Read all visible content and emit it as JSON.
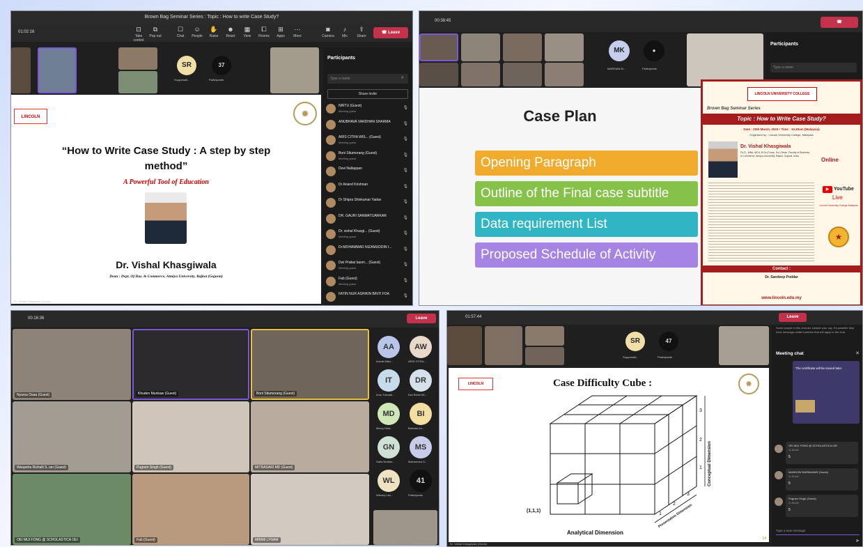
{
  "panel1": {
    "window_title": "Brown Bag Seminar Series : Topic : How to write Case Study?",
    "timer": "01:02:16",
    "toolbar": [
      "Take control",
      "Pop out",
      "Chat",
      "People",
      "Raise",
      "React",
      "View",
      "Rooms",
      "Apps",
      "More",
      "Camera",
      "Mic",
      "Share"
    ],
    "leave_label": "Leave",
    "tiles": {
      "sr_initials": "SR",
      "sr_name": "Suppamali...",
      "participants_count": "37",
      "participants_label": "Participants"
    },
    "participants_header": "Participants",
    "search_placeholder": "Type a name",
    "share_invite": "Share invite",
    "participants": [
      {
        "name": "NIRTU (Guest)",
        "sub": "Meeting guest"
      },
      {
        "name": "ANUBHAVA VARDHAN SHARMA",
        "sub": ""
      },
      {
        "name": "ARIS CITRA WIS... (Guest)",
        "sub": "Meeting guest"
      },
      {
        "name": "Boni Situmorang (Guest)",
        "sub": "Meeting guest"
      },
      {
        "name": "Devi Nallappan",
        "sub": ""
      },
      {
        "name": "Dr Anand Krishnan",
        "sub": ""
      },
      {
        "name": "Dr Shipra Shivkumar Yadav",
        "sub": ""
      },
      {
        "name": "DR. GAURI SANMATIJARKAR",
        "sub": ""
      },
      {
        "name": "Dr. vishal Khasgi... (Guest)",
        "sub": "Meeting guest"
      },
      {
        "name": "Dr.MOHAMMAD NIZAMUDDIN I...",
        "sub": ""
      },
      {
        "name": "Dwi Prabai basm... (Guest)",
        "sub": "Meeting guest"
      },
      {
        "name": "Fab (Guest)",
        "sub": "Meeting guest"
      },
      {
        "name": "FATIN NUR ASHIKIN BINTI FOA",
        "sub": ""
      }
    ],
    "slide": {
      "title_line1": "“How to Write Case Study : A step by step",
      "title_line2": "method”",
      "subtitle": "A Powerful Tool of Education",
      "speaker": "Dr. Vishal Khasgiwala",
      "affiliation": "Dean : Dept. Of Bus. & Commerce, Atmiya University, Rajkot (Gujarat)",
      "logo_text": "LINCOLN"
    },
    "presenter_label": "Dr. Vishal Khasgiwala (Guest)"
  },
  "panel2": {
    "timer": "00:38:45",
    "tiles": {
      "mk_initials": "MK",
      "mk_name": "MARDIAN M...",
      "participants_label": "Participants"
    },
    "participants_header": "Participants",
    "search_placeholder": "Type a name",
    "slide": {
      "title": "Case Plan",
      "items": [
        "Opening Paragraph",
        "Outline of the Final case subtitle wise",
        "Data requirement List",
        "Proposed Schedule of Activity"
      ]
    },
    "poster": {
      "logo": "LINCOLN UNIVERSITY COLLEGE",
      "series": "Brown Bag Seminar Series",
      "topic": "Topic : How to Write Case Study?",
      "date_line": "Date : 20th March, 2023 • Time : 10.30am (Malaysia)",
      "organised": "Organised by : Lincoln University College, Malaysia",
      "speaker": "Dr. Vishal Khasgiwala",
      "speaker_sub": "Ph.D., MBA, MCA, B.Sc.(Comp. Sci.) Dean, Faculty of Business & Commerce, Atmiya University, Rajkot, Gujarat, India",
      "online": "Online",
      "youtube": "YouTube",
      "live": "Live",
      "channel": "Lincoln University College Malaysia",
      "contact": "Contact :",
      "contact_name": "Dr. Sandeep Poddar",
      "website": "www.lincoln.edu.my"
    }
  },
  "panel3": {
    "timer": "00:16:36",
    "leave_label": "Leave",
    "videos": [
      {
        "name": "Nyarsa Osaa (Guest)"
      },
      {
        "name": "Khuden Munkaw (Guest)"
      },
      {
        "name": "Boni Situmorang (Guest)"
      },
      {
        "name": "Waspetra Rizhalli S. ian (Guest)"
      },
      {
        "name": "Pugram Singh (Guest)"
      },
      {
        "name": "MITRASARI MD (Guest)"
      },
      {
        "name": "OEI MUI FONG @ SCHOLASTICA OEI"
      },
      {
        "name": "Fab (Guest)"
      },
      {
        "name": "MIMMI LYNAM"
      }
    ],
    "gallery": [
      {
        "initials": "AA",
        "name": "Amrali Misri...",
        "color": "#b8c4e8"
      },
      {
        "initials": "AW",
        "name": "ARIS CITRA...",
        "color": "#e9d9c9"
      },
      {
        "initials": "IT",
        "name": "Irmu Trisnadi...",
        "color": "#c6dcea"
      },
      {
        "initials": "DR",
        "name": "Dwi Rezki Wi...",
        "color": "#d5e0ea"
      },
      {
        "initials": "MD",
        "name": "Mercy Dela...",
        "color": "#cfe7b7"
      },
      {
        "initials": "BI",
        "name": "Barbara Irv...",
        "color": "#f4dfa3"
      },
      {
        "initials": "GN",
        "name": "Gaila Nurilan...",
        "color": "#cfe0d4"
      },
      {
        "initials": "MS",
        "name": "Mahnomed S...",
        "color": "#c9cce8"
      },
      {
        "initials": "WL",
        "name": "Wincey Lau...",
        "color": "#efe2c0"
      },
      {
        "initials": "41",
        "name": "Participants",
        "color": "#111111"
      }
    ]
  },
  "panel4": {
    "timer": "01:57:44",
    "tiles": {
      "sr_initials": "SR",
      "sr_name": "Suppamali...",
      "participants_count": "47",
      "participants_label": "Participants"
    },
    "leave_label": "Leave",
    "chat_header": "Meeting chat",
    "chat_notice": "Some people in this chat are outside your org. It's possible they have message-related policies that will apply to the chat.",
    "chat_bubble": "The certificate will be issued later.",
    "messages": [
      {
        "name": "OEI MUI FONG @ SCHOLASTICA OEI",
        "time": "11:28 AM",
        "text": "5"
      },
      {
        "name": "MANDOW BARMANAR (Guest)",
        "time": "11:28 AM",
        "text": "5"
      },
      {
        "name": "Pugram Singh (Guest)",
        "time": "11:28 AM",
        "text": "5"
      }
    ],
    "chat_placeholder": "Type a new message",
    "slide": {
      "title": "Case Difficulty Cube :",
      "origin": "(1,1,1)",
      "x_axis": "Analytical Dimension",
      "y_axis": "Conceptual Dimension",
      "z_axis": "Presentation Dimension",
      "ticks_x": [
        "1",
        "2",
        "3"
      ],
      "ticks_y": [
        "1",
        "2",
        "3"
      ]
    },
    "presenter_label": "Dr. Vishal Khasgiwala (Guest)",
    "slide_number": "14"
  }
}
